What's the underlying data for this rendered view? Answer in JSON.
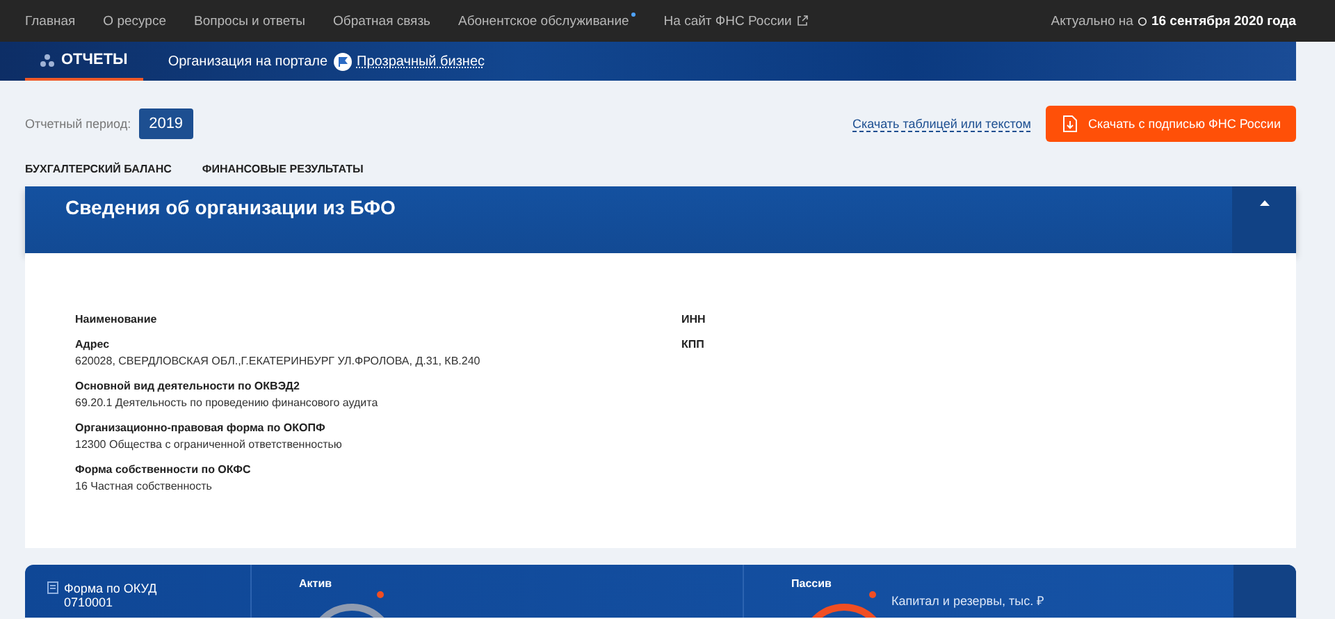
{
  "top_nav": {
    "links": [
      {
        "label": "Главная",
        "kind": "plain"
      },
      {
        "label": "О ресурсе",
        "kind": "plain"
      },
      {
        "label": "Вопросы и ответы",
        "kind": "plain"
      },
      {
        "label": "Обратная связь",
        "kind": "plain"
      },
      {
        "label": "Абонентское обслуживание",
        "kind": "new"
      },
      {
        "label": "На сайт ФНС России",
        "kind": "external"
      }
    ],
    "updated_label": "Актуально на",
    "updated_date": "16 сентября 2020 года"
  },
  "banner": {
    "items": [
      {
        "label": "ОТЧЕТЫ",
        "kind": "tab",
        "selected": true
      },
      {
        "label": "Организация на портале",
        "kind": "link",
        "selected": false
      },
      {
        "label": "Прозрачный бизнес",
        "kind": "brand",
        "selected": false
      }
    ]
  },
  "toolbar": {
    "period_label": "Отчетный период:",
    "period_value": "2019",
    "download_link": "Скачать таблицей или текстом",
    "sign_button": "Скачать с подписью ФНС России"
  },
  "report_tabs": [
    {
      "label": "БУХГАЛТЕРСКИЙ БАЛАНС"
    },
    {
      "label": "ФИНАНСОВЫЕ РЕЗУЛЬТАТЫ"
    }
  ],
  "org_card": {
    "title": "Сведения об организации из БФО",
    "expanded": true,
    "left_fields": [
      {
        "label": "Наименование"
      },
      {
        "label": "Адрес",
        "value": "620028, СВЕРДЛОВСКАЯ ОБЛ.,Г.ЕКАТЕРИНБУРГ УЛ.ФРОЛОВА, Д.31, КВ.240"
      },
      {
        "label": "Основной вид деятельности по ОКВЭД2",
        "value": "69.20.1 Деятельность по проведению финансового аудита"
      },
      {
        "label": "Организационно-правовая форма по ОКОПФ",
        "value": "12300 Общества с ограниченной ответственностью"
      },
      {
        "label": "Форма собственности по ОКФС",
        "value": "16 Частная собственность"
      }
    ],
    "right_fields": [
      {
        "label": "ИНН"
      },
      {
        "label": "КПП"
      }
    ]
  },
  "summary": {
    "okud_label": "Форма по ОКУД",
    "okud_code": "0710001",
    "sections": [
      {
        "title": "Актив",
        "color": "#8f9bb0"
      },
      {
        "title": "Пассив",
        "color": "#f04e23",
        "item": "Капитал и резервы, тыс. ₽"
      }
    ]
  }
}
